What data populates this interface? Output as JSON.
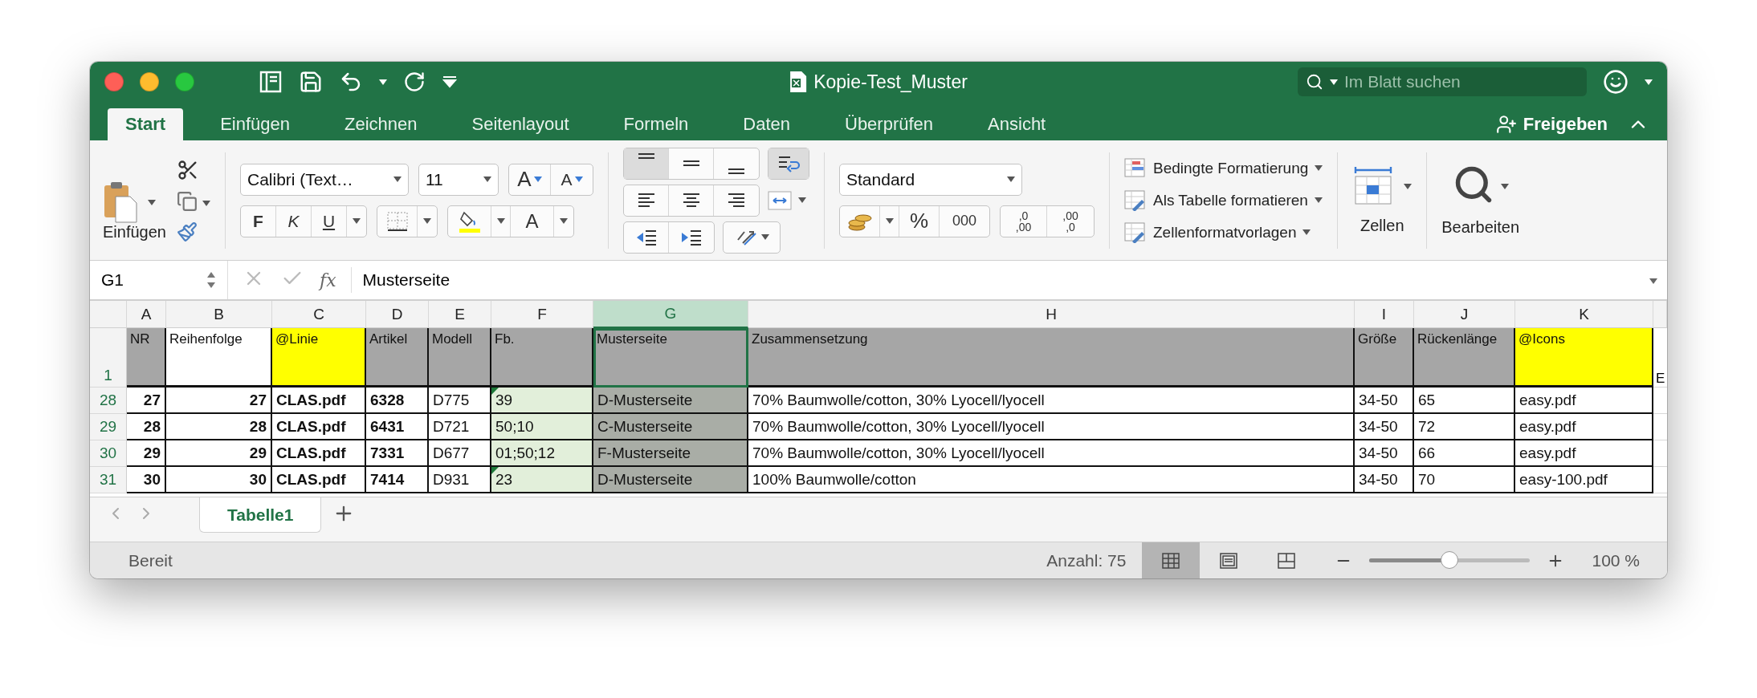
{
  "window": {
    "title": "Kopie-Test_Muster",
    "search_placeholder": "Im Blatt suchen"
  },
  "tabs": [
    {
      "label": "Start",
      "selected": true
    },
    {
      "label": "Einfügen",
      "selected": false
    },
    {
      "label": "Zeichnen",
      "selected": false
    },
    {
      "label": "Seitenlayout",
      "selected": false
    },
    {
      "label": "Formeln",
      "selected": false
    },
    {
      "label": "Daten",
      "selected": false
    },
    {
      "label": "Überprüfen",
      "selected": false
    },
    {
      "label": "Ansicht",
      "selected": false
    }
  ],
  "share_button": "Freigeben",
  "ribbon": {
    "paste": "Einfügen",
    "font_name": "Calibri (Text…",
    "font_size": "11",
    "grow_font": "A",
    "shrink_font": "A",
    "bold": "F",
    "italic": "K",
    "underline": "U",
    "font_color": "A",
    "number_format": "Standard",
    "percent": "%",
    "thousands": "000",
    "decimal_more": [
      ",0",
      ",00"
    ],
    "decimal_less": [
      ",00",
      ",0"
    ],
    "styles": [
      "Bedingte Formatierung",
      "Als Tabelle formatieren",
      "Zellenformatvorlagen"
    ],
    "cells": "Zellen",
    "editing": "Bearbeiten"
  },
  "formula_bar": {
    "cell_ref": "G1",
    "fx": "fx",
    "value": "Musterseite"
  },
  "sheet": {
    "header_row_number": "1",
    "columns": [
      {
        "letter": "A",
        "header": "NR",
        "color": "#a6a6a6",
        "kind": "bold_number",
        "selected": false
      },
      {
        "letter": "B",
        "header": "Reihenfolge",
        "color": "#ffffff",
        "kind": "bold_number",
        "selected": false
      },
      {
        "letter": "C",
        "header": "@Linie",
        "color": "#ffff00",
        "kind": "bold_text",
        "selected": false
      },
      {
        "letter": "D",
        "header": "Artikel",
        "color": "#a6a6a6",
        "kind": "bold_text",
        "selected": false
      },
      {
        "letter": "E",
        "header": "Modell",
        "color": "#a6a6a6",
        "kind": "text",
        "selected": false
      },
      {
        "letter": "F",
        "header": "Fb.",
        "color": "#a6a6a6",
        "kind": "marked",
        "selected": false
      },
      {
        "letter": "G",
        "header": "Musterseite",
        "color": "#a6a6a6",
        "kind": "text",
        "selected": true
      },
      {
        "letter": "H",
        "header": "Zusammensetzung",
        "color": "#a6a6a6",
        "kind": "text",
        "selected": false
      },
      {
        "letter": "I",
        "header": "Größe",
        "color": "#a6a6a6",
        "kind": "text",
        "selected": false
      },
      {
        "letter": "J",
        "header": "Rückenlänge",
        "color": "#a6a6a6",
        "kind": "text",
        "selected": false
      },
      {
        "letter": "K",
        "header": "@Icons",
        "color": "#ffff00",
        "kind": "text",
        "selected": false
      }
    ],
    "partial_column_header": "E",
    "rows": [
      {
        "number": "28",
        "flagged": true,
        "cells": [
          "27",
          "27",
          "CLAS.pdf",
          "6328",
          "D775",
          "39",
          "D-Musterseite",
          "70% Baumwolle/cotton, 30% Lyocell/lyocell",
          "34-50",
          "65",
          "easy.pdf"
        ]
      },
      {
        "number": "29",
        "flagged": false,
        "cells": [
          "28",
          "28",
          "CLAS.pdf",
          "6431",
          "D721",
          "50;10",
          "C-Musterseite",
          "70% Baumwolle/cotton, 30% Lyocell/lyocell",
          "34-50",
          "72",
          "easy.pdf"
        ]
      },
      {
        "number": "30",
        "flagged": false,
        "cells": [
          "29",
          "29",
          "CLAS.pdf",
          "7331",
          "D677",
          "01;50;12",
          "F-Musterseite",
          "70% Baumwolle/cotton, 30% Lyocell/lyocell",
          "34-50",
          "66",
          "easy.pdf"
        ]
      },
      {
        "number": "31",
        "flagged": true,
        "cells": [
          "30",
          "30",
          "CLAS.pdf",
          "7414",
          "D931",
          "23",
          "D-Musterseite",
          "100% Baumwolle/cotton",
          "34-50",
          "70",
          "easy-100.pdf"
        ]
      }
    ]
  },
  "sheet_tabs": [
    {
      "label": "Tabelle1",
      "selected": true
    }
  ],
  "status_bar": {
    "status": "Bereit",
    "count": "Anzahl: 75",
    "views": [
      {
        "kind": "normal",
        "selected": true
      },
      {
        "kind": "page_layout",
        "selected": false
      },
      {
        "kind": "page_break",
        "selected": false
      }
    ],
    "zoom": {
      "level": 0.5,
      "reading": "100 %"
    }
  }
}
